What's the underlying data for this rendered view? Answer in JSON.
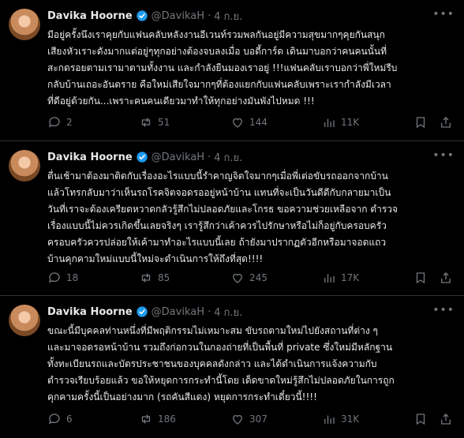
{
  "colors": {
    "background": "#000000",
    "text": "#e7e9ea",
    "muted": "#71767b",
    "verified": "#1d9bf0",
    "divider": "#2f3336"
  },
  "tweets": [
    {
      "name": "Davika Hoorne",
      "handle": "@DavikaH",
      "separator": "·",
      "date": "4 ก.ย.",
      "text": "มีอยู่ครั้งนึงเราคุยกับแฟนคลับหลังงานอีเวนท์รวมพลกันอยู่มีความสุขมากๆคุยกันสนุก\nเสียงหัวเราะดังมากแต่อยู่ๆทุกอย่างต้องจบลงเมื่อ บอดี้การ์ด เดินมาบอกว่าคนคนนั้นที่\nสะกดรอยตามเรามาตามทั้งงาน และกำลังยืนมองเราอยู่ !!!แฟนคลับเราบอกว่าพี่ใหม่รีบ\nกลับบ้านเถอะอันตราย คือใหม่เสียใจมากๆที่ต้องแยกกับแฟนคลับเพราะเรากำลังมีเวลา\nที่ดีอยู่ด้วยกัน...เพราะคนคนเดียวมาทำให้ทุกอย่างมันพังไปหมด !!!",
      "replies": "2",
      "reposts": "51",
      "likes": "144",
      "views": "11K"
    },
    {
      "name": "Davika Hoorne",
      "handle": "@DavikaH",
      "separator": "·",
      "date": "4 ก.ย.",
      "text": "ตื่นเช้ามาต้องมาติดกับเรื่องอะไรแบบนี้รำคาญจิตใจมากๆเมื่อพี่เต่อขับรถออกจากบ้าน\nแล้วโทรกลับมาว่าเห็นรถโรคจิตจอดรออยู่หน้าบ้าน แทนที่จะเป็นวันดีดีกับกลายมาเป็น\nวันที่เราจะต้องเครียดหวาดกลัวรู้สึกไม่ปลอดภัยและโกรธ ขอความช่วยเหลือจาก ตำรวจ\nเรื่องแบบนี้ไม่ควรเกิดขึ้นเลยจริงๆ เรารู้สึกว่าเค้าควรไปรักษาหรือไม่ก็อยู่กับครอบครัว\nครอบครัวควรปล่อยให้เค้ามาทำอะไรแบบนี้เลย ถ้ายังมาปรากฏตัวอีกหรือมาจอดแถว\nบ้านคุกคามใหม่แบบนี้ใหม่จะดำเนินการให้ถึงที่สุด!!!!",
      "replies": "18",
      "reposts": "85",
      "likes": "245",
      "views": "17K"
    },
    {
      "name": "Davika Hoorne",
      "handle": "@DavikaH",
      "separator": "·",
      "date": "4 ก.ย.",
      "text": "ขณะนี้มีบุคคลท่านหนึ่งที่มีพฤติกรรมไม่เหมาะสม ขับรถตามใหม่ไปยังสถานที่ต่าง ๆ\nและมาจอดรอหน้าบ้าน รวมถึงก่อกวนในกองถ่ายที่เป็นพื้นที่ private ซึ่งใหม่มีหลักฐาน\nทั้งทะเบียนรถและบัตรประชาชนของบุคคลดังกล่าว และได้ดำเนินการแจ้งความกับ\nตำรวจเรียบร้อยแล้ว ขอให้หยุดการกระทำนี้โดย เด็ดขาดใหม่รู้สึกไม่ปลอดภัยในการถูก\nคุกคามครั้งนี้เป็นอย่างมาก (รถคันสีแดง) หยุดการกระทำเดี๋ยวนี้!!!!",
      "replies": "6",
      "reposts": "186",
      "likes": "307",
      "views": "31K"
    }
  ],
  "icons": {
    "verified": "verified-badge-icon",
    "more": "more-icon",
    "reply": "reply-icon",
    "repost": "repost-icon",
    "like": "like-icon",
    "views": "views-icon",
    "bookmark": "bookmark-icon",
    "share": "share-icon"
  }
}
